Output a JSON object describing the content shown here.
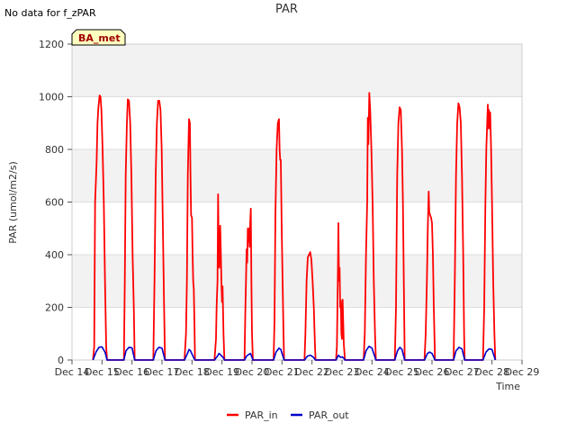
{
  "header": {
    "note": "No data for f_zPAR"
  },
  "badge": {
    "label": "BA_met"
  },
  "chart_data": {
    "type": "line",
    "title": "PAR",
    "xlabel": "Time",
    "ylabel": "PAR (umol/m2/s)",
    "xlim": [
      14,
      29
    ],
    "ylim": [
      0,
      1200
    ],
    "x_ticks": [
      {
        "value": 14,
        "label": "Dec 14"
      },
      {
        "value": 15,
        "label": "Dec 15"
      },
      {
        "value": 16,
        "label": "Dec 16"
      },
      {
        "value": 17,
        "label": "Dec 17"
      },
      {
        "value": 18,
        "label": "Dec 18"
      },
      {
        "value": 19,
        "label": "Dec 19"
      },
      {
        "value": 20,
        "label": "Dec 20"
      },
      {
        "value": 21,
        "label": "Dec 21"
      },
      {
        "value": 22,
        "label": "Dec 22"
      },
      {
        "value": 23,
        "label": "Dec 23"
      },
      {
        "value": 24,
        "label": "Dec 24"
      },
      {
        "value": 25,
        "label": "Dec 25"
      },
      {
        "value": 26,
        "label": "Dec 26"
      },
      {
        "value": 27,
        "label": "Dec 27"
      },
      {
        "value": 28,
        "label": "Dec 28"
      },
      {
        "value": 29,
        "label": "Dec 29"
      }
    ],
    "y_ticks": [
      0,
      200,
      400,
      600,
      800,
      1000,
      1200
    ],
    "grid": true,
    "banded_background": true,
    "legend_position": "bottom-center",
    "series": [
      {
        "name": "PAR_in",
        "color": "#ff0000",
        "points": [
          [
            14.7,
            0
          ],
          [
            14.74,
            50
          ],
          [
            14.77,
            600
          ],
          [
            14.82,
            750
          ],
          [
            14.85,
            900
          ],
          [
            14.88,
            960
          ],
          [
            14.92,
            1005
          ],
          [
            14.95,
            1000
          ],
          [
            14.98,
            950
          ],
          [
            15.02,
            800
          ],
          [
            15.06,
            600
          ],
          [
            15.1,
            300
          ],
          [
            15.14,
            50
          ],
          [
            15.17,
            0
          ],
          [
            15.73,
            0
          ],
          [
            15.76,
            300
          ],
          [
            15.79,
            700
          ],
          [
            15.83,
            900
          ],
          [
            15.86,
            990
          ],
          [
            15.9,
            985
          ],
          [
            15.94,
            900
          ],
          [
            15.98,
            700
          ],
          [
            16.02,
            400
          ],
          [
            16.06,
            200
          ],
          [
            16.09,
            0
          ],
          [
            16.71,
            0
          ],
          [
            16.75,
            300
          ],
          [
            16.79,
            700
          ],
          [
            16.83,
            900
          ],
          [
            16.87,
            985
          ],
          [
            16.91,
            985
          ],
          [
            16.95,
            950
          ],
          [
            16.99,
            800
          ],
          [
            17.03,
            500
          ],
          [
            17.07,
            200
          ],
          [
            17.1,
            0
          ],
          [
            17.75,
            0
          ],
          [
            17.8,
            100
          ],
          [
            17.83,
            300
          ],
          [
            17.86,
            700
          ],
          [
            17.9,
            915
          ],
          [
            17.93,
            900
          ],
          [
            17.95,
            700
          ],
          [
            17.97,
            550
          ],
          [
            18.0,
            540
          ],
          [
            18.02,
            400
          ],
          [
            18.04,
            300
          ],
          [
            18.06,
            270
          ],
          [
            18.08,
            150
          ],
          [
            18.1,
            0
          ],
          [
            18.75,
            0
          ],
          [
            18.8,
            80
          ],
          [
            18.82,
            200
          ],
          [
            18.85,
            300
          ],
          [
            18.87,
            630
          ],
          [
            18.89,
            400
          ],
          [
            18.91,
            350
          ],
          [
            18.94,
            510
          ],
          [
            18.96,
            420
          ],
          [
            18.98,
            300
          ],
          [
            19.0,
            220
          ],
          [
            19.02,
            280
          ],
          [
            19.05,
            100
          ],
          [
            19.08,
            0
          ],
          [
            19.75,
            0
          ],
          [
            19.78,
            200
          ],
          [
            19.8,
            300
          ],
          [
            19.82,
            420
          ],
          [
            19.84,
            370
          ],
          [
            19.86,
            500
          ],
          [
            19.88,
            450
          ],
          [
            19.9,
            500
          ],
          [
            19.92,
            430
          ],
          [
            19.94,
            520
          ],
          [
            19.96,
            575
          ],
          [
            19.98,
            300
          ],
          [
            20.0,
            100
          ],
          [
            20.03,
            0
          ],
          [
            20.72,
            0
          ],
          [
            20.75,
            150
          ],
          [
            20.78,
            550
          ],
          [
            20.82,
            800
          ],
          [
            20.86,
            900
          ],
          [
            20.9,
            915
          ],
          [
            20.92,
            800
          ],
          [
            20.94,
            760
          ],
          [
            20.96,
            760
          ],
          [
            20.99,
            500
          ],
          [
            21.02,
            300
          ],
          [
            21.05,
            100
          ],
          [
            21.07,
            0
          ],
          [
            21.75,
            0
          ],
          [
            21.78,
            100
          ],
          [
            21.82,
            300
          ],
          [
            21.86,
            390
          ],
          [
            21.9,
            400
          ],
          [
            21.94,
            410
          ],
          [
            21.98,
            380
          ],
          [
            22.02,
            300
          ],
          [
            22.06,
            200
          ],
          [
            22.1,
            50
          ],
          [
            22.12,
            0
          ],
          [
            22.8,
            0
          ],
          [
            22.83,
            50
          ],
          [
            22.86,
            300
          ],
          [
            22.88,
            520
          ],
          [
            22.9,
            300
          ],
          [
            22.92,
            350
          ],
          [
            22.94,
            200
          ],
          [
            22.96,
            225
          ],
          [
            22.98,
            100
          ],
          [
            23.0,
            80
          ],
          [
            23.02,
            230
          ],
          [
            23.04,
            150
          ],
          [
            23.06,
            60
          ],
          [
            23.1,
            0
          ],
          [
            23.72,
            0
          ],
          [
            23.76,
            100
          ],
          [
            23.8,
            400
          ],
          [
            23.84,
            600
          ],
          [
            23.86,
            920
          ],
          [
            23.88,
            820
          ],
          [
            23.91,
            1015
          ],
          [
            23.94,
            950
          ],
          [
            23.98,
            800
          ],
          [
            24.02,
            600
          ],
          [
            24.06,
            300
          ],
          [
            24.1,
            100
          ],
          [
            24.13,
            0
          ],
          [
            24.76,
            0
          ],
          [
            24.8,
            200
          ],
          [
            24.84,
            700
          ],
          [
            24.88,
            900
          ],
          [
            24.92,
            960
          ],
          [
            24.96,
            950
          ],
          [
            25.0,
            800
          ],
          [
            25.03,
            600
          ],
          [
            25.06,
            300
          ],
          [
            25.09,
            0
          ],
          [
            25.75,
            0
          ],
          [
            25.79,
            100
          ],
          [
            25.83,
            300
          ],
          [
            25.86,
            500
          ],
          [
            25.89,
            640
          ],
          [
            25.91,
            560
          ],
          [
            25.94,
            550
          ],
          [
            25.97,
            540
          ],
          [
            26.0,
            520
          ],
          [
            26.03,
            400
          ],
          [
            26.06,
            200
          ],
          [
            26.1,
            0
          ],
          [
            26.72,
            0
          ],
          [
            26.76,
            300
          ],
          [
            26.8,
            700
          ],
          [
            26.84,
            900
          ],
          [
            26.88,
            975
          ],
          [
            26.92,
            960
          ],
          [
            26.96,
            900
          ],
          [
            27.0,
            700
          ],
          [
            27.04,
            400
          ],
          [
            27.07,
            100
          ],
          [
            27.09,
            0
          ],
          [
            27.7,
            0
          ],
          [
            27.74,
            200
          ],
          [
            27.78,
            600
          ],
          [
            27.81,
            800
          ],
          [
            27.84,
            900
          ],
          [
            27.86,
            970
          ],
          [
            27.88,
            880
          ],
          [
            27.9,
            950
          ],
          [
            27.92,
            880
          ],
          [
            27.94,
            940
          ],
          [
            27.97,
            800
          ],
          [
            28.0,
            600
          ],
          [
            28.04,
            300
          ],
          [
            28.08,
            100
          ],
          [
            28.11,
            0
          ]
        ]
      },
      {
        "name": "PAR_out",
        "color": "#0000cc",
        "points": [
          [
            14.7,
            0
          ],
          [
            14.8,
            30
          ],
          [
            14.9,
            48
          ],
          [
            15.0,
            50
          ],
          [
            15.1,
            30
          ],
          [
            15.17,
            0
          ],
          [
            15.73,
            0
          ],
          [
            15.8,
            35
          ],
          [
            15.9,
            48
          ],
          [
            16.0,
            46
          ],
          [
            16.09,
            0
          ],
          [
            16.71,
            0
          ],
          [
            16.8,
            35
          ],
          [
            16.9,
            48
          ],
          [
            17.0,
            45
          ],
          [
            17.1,
            0
          ],
          [
            17.75,
            0
          ],
          [
            17.85,
            25
          ],
          [
            17.9,
            40
          ],
          [
            17.95,
            35
          ],
          [
            18.05,
            10
          ],
          [
            18.1,
            0
          ],
          [
            18.75,
            0
          ],
          [
            18.85,
            15
          ],
          [
            18.9,
            25
          ],
          [
            18.95,
            20
          ],
          [
            19.05,
            8
          ],
          [
            19.08,
            0
          ],
          [
            19.75,
            0
          ],
          [
            19.82,
            15
          ],
          [
            19.88,
            20
          ],
          [
            19.95,
            25
          ],
          [
            20.0,
            10
          ],
          [
            20.03,
            0
          ],
          [
            20.72,
            0
          ],
          [
            20.8,
            30
          ],
          [
            20.9,
            45
          ],
          [
            20.96,
            40
          ],
          [
            21.07,
            0
          ],
          [
            21.75,
            0
          ],
          [
            21.85,
            15
          ],
          [
            21.95,
            18
          ],
          [
            22.05,
            10
          ],
          [
            22.12,
            0
          ],
          [
            22.8,
            0
          ],
          [
            22.88,
            18
          ],
          [
            22.95,
            10
          ],
          [
            23.0,
            12
          ],
          [
            23.05,
            8
          ],
          [
            23.1,
            0
          ],
          [
            23.72,
            0
          ],
          [
            23.8,
            35
          ],
          [
            23.9,
            52
          ],
          [
            24.0,
            45
          ],
          [
            24.13,
            0
          ],
          [
            24.76,
            0
          ],
          [
            24.85,
            35
          ],
          [
            24.93,
            48
          ],
          [
            25.0,
            40
          ],
          [
            25.09,
            0
          ],
          [
            25.75,
            0
          ],
          [
            25.85,
            25
          ],
          [
            25.92,
            30
          ],
          [
            26.0,
            25
          ],
          [
            26.1,
            0
          ],
          [
            26.72,
            0
          ],
          [
            26.8,
            35
          ],
          [
            26.9,
            48
          ],
          [
            27.0,
            42
          ],
          [
            27.09,
            0
          ],
          [
            27.7,
            0
          ],
          [
            27.8,
            30
          ],
          [
            27.9,
            42
          ],
          [
            28.0,
            40
          ],
          [
            28.11,
            0
          ]
        ]
      }
    ]
  }
}
